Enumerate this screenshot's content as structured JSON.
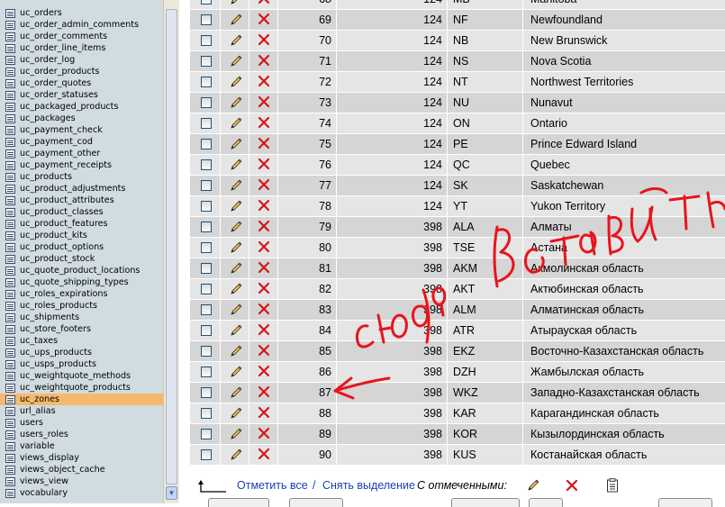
{
  "sidebar": {
    "tables": [
      "uc_orders",
      "uc_order_admin_comments",
      "uc_order_comments",
      "uc_order_line_items",
      "uc_order_log",
      "uc_order_products",
      "uc_order_quotes",
      "uc_order_statuses",
      "uc_packaged_products",
      "uc_packages",
      "uc_payment_check",
      "uc_payment_cod",
      "uc_payment_other",
      "uc_payment_receipts",
      "uc_products",
      "uc_product_adjustments",
      "uc_product_attributes",
      "uc_product_classes",
      "uc_product_features",
      "uc_product_kits",
      "uc_product_options",
      "uc_product_stock",
      "uc_quote_product_locations",
      "uc_quote_shipping_types",
      "uc_roles_expirations",
      "uc_roles_products",
      "uc_shipments",
      "uc_store_footers",
      "uc_taxes",
      "uc_ups_products",
      "uc_usps_products",
      "uc_weightquote_methods",
      "uc_weightquote_products",
      "uc_zones",
      "url_alias",
      "users",
      "users_roles",
      "variable",
      "views_display",
      "views_object_cache",
      "views_view",
      "vocabulary"
    ],
    "active": "uc_zones"
  },
  "rows": [
    {
      "id": "68",
      "country": "124",
      "code": "MB",
      "name": "Manitoba"
    },
    {
      "id": "69",
      "country": "124",
      "code": "NF",
      "name": "Newfoundland"
    },
    {
      "id": "70",
      "country": "124",
      "code": "NB",
      "name": "New Brunswick"
    },
    {
      "id": "71",
      "country": "124",
      "code": "NS",
      "name": "Nova Scotia"
    },
    {
      "id": "72",
      "country": "124",
      "code": "NT",
      "name": "Northwest Territories"
    },
    {
      "id": "73",
      "country": "124",
      "code": "NU",
      "name": "Nunavut"
    },
    {
      "id": "74",
      "country": "124",
      "code": "ON",
      "name": "Ontario"
    },
    {
      "id": "75",
      "country": "124",
      "code": "PE",
      "name": "Prince Edward Island"
    },
    {
      "id": "76",
      "country": "124",
      "code": "QC",
      "name": "Quebec"
    },
    {
      "id": "77",
      "country": "124",
      "code": "SK",
      "name": "Saskatchewan"
    },
    {
      "id": "78",
      "country": "124",
      "code": "YT",
      "name": "Yukon Territory"
    },
    {
      "id": "79",
      "country": "398",
      "code": "ALA",
      "name": "Алматы"
    },
    {
      "id": "80",
      "country": "398",
      "code": "TSE",
      "name": "Астана"
    },
    {
      "id": "81",
      "country": "398",
      "code": "AKM",
      "name": "Акмолинская область"
    },
    {
      "id": "82",
      "country": "398",
      "code": "AKT",
      "name": "Актюбинская область"
    },
    {
      "id": "83",
      "country": "398",
      "code": "ALM",
      "name": "Алматинская область"
    },
    {
      "id": "84",
      "country": "398",
      "code": "ATR",
      "name": "Атырауская область"
    },
    {
      "id": "85",
      "country": "398",
      "code": "EKZ",
      "name": "Восточно-Казахстанская область"
    },
    {
      "id": "86",
      "country": "398",
      "code": "DZH",
      "name": "Жамбылская область"
    },
    {
      "id": "87",
      "country": "398",
      "code": "WKZ",
      "name": "Западно-Казахстанская область"
    },
    {
      "id": "88",
      "country": "398",
      "code": "KAR",
      "name": "Карагандинская область"
    },
    {
      "id": "89",
      "country": "398",
      "code": "KOR",
      "name": "Кызылординская область"
    },
    {
      "id": "90",
      "country": "398",
      "code": "KUS",
      "name": "Костанайская область"
    }
  ],
  "footer": {
    "select_all": "Отметить все",
    "separator": "/",
    "unselect_all": "Снять выделение",
    "with_selected": "С отмеченными:"
  },
  "annotation": {
    "text_1": "сюда",
    "text_2": "вставить",
    "color": "#e8141c"
  },
  "colors": {
    "row_even": "#e5e5e5",
    "row_odd": "#d5d5d5",
    "active_table": "#f5b96e",
    "sidebar_bg": "#d0dce0",
    "link": "#1a3fb8"
  }
}
